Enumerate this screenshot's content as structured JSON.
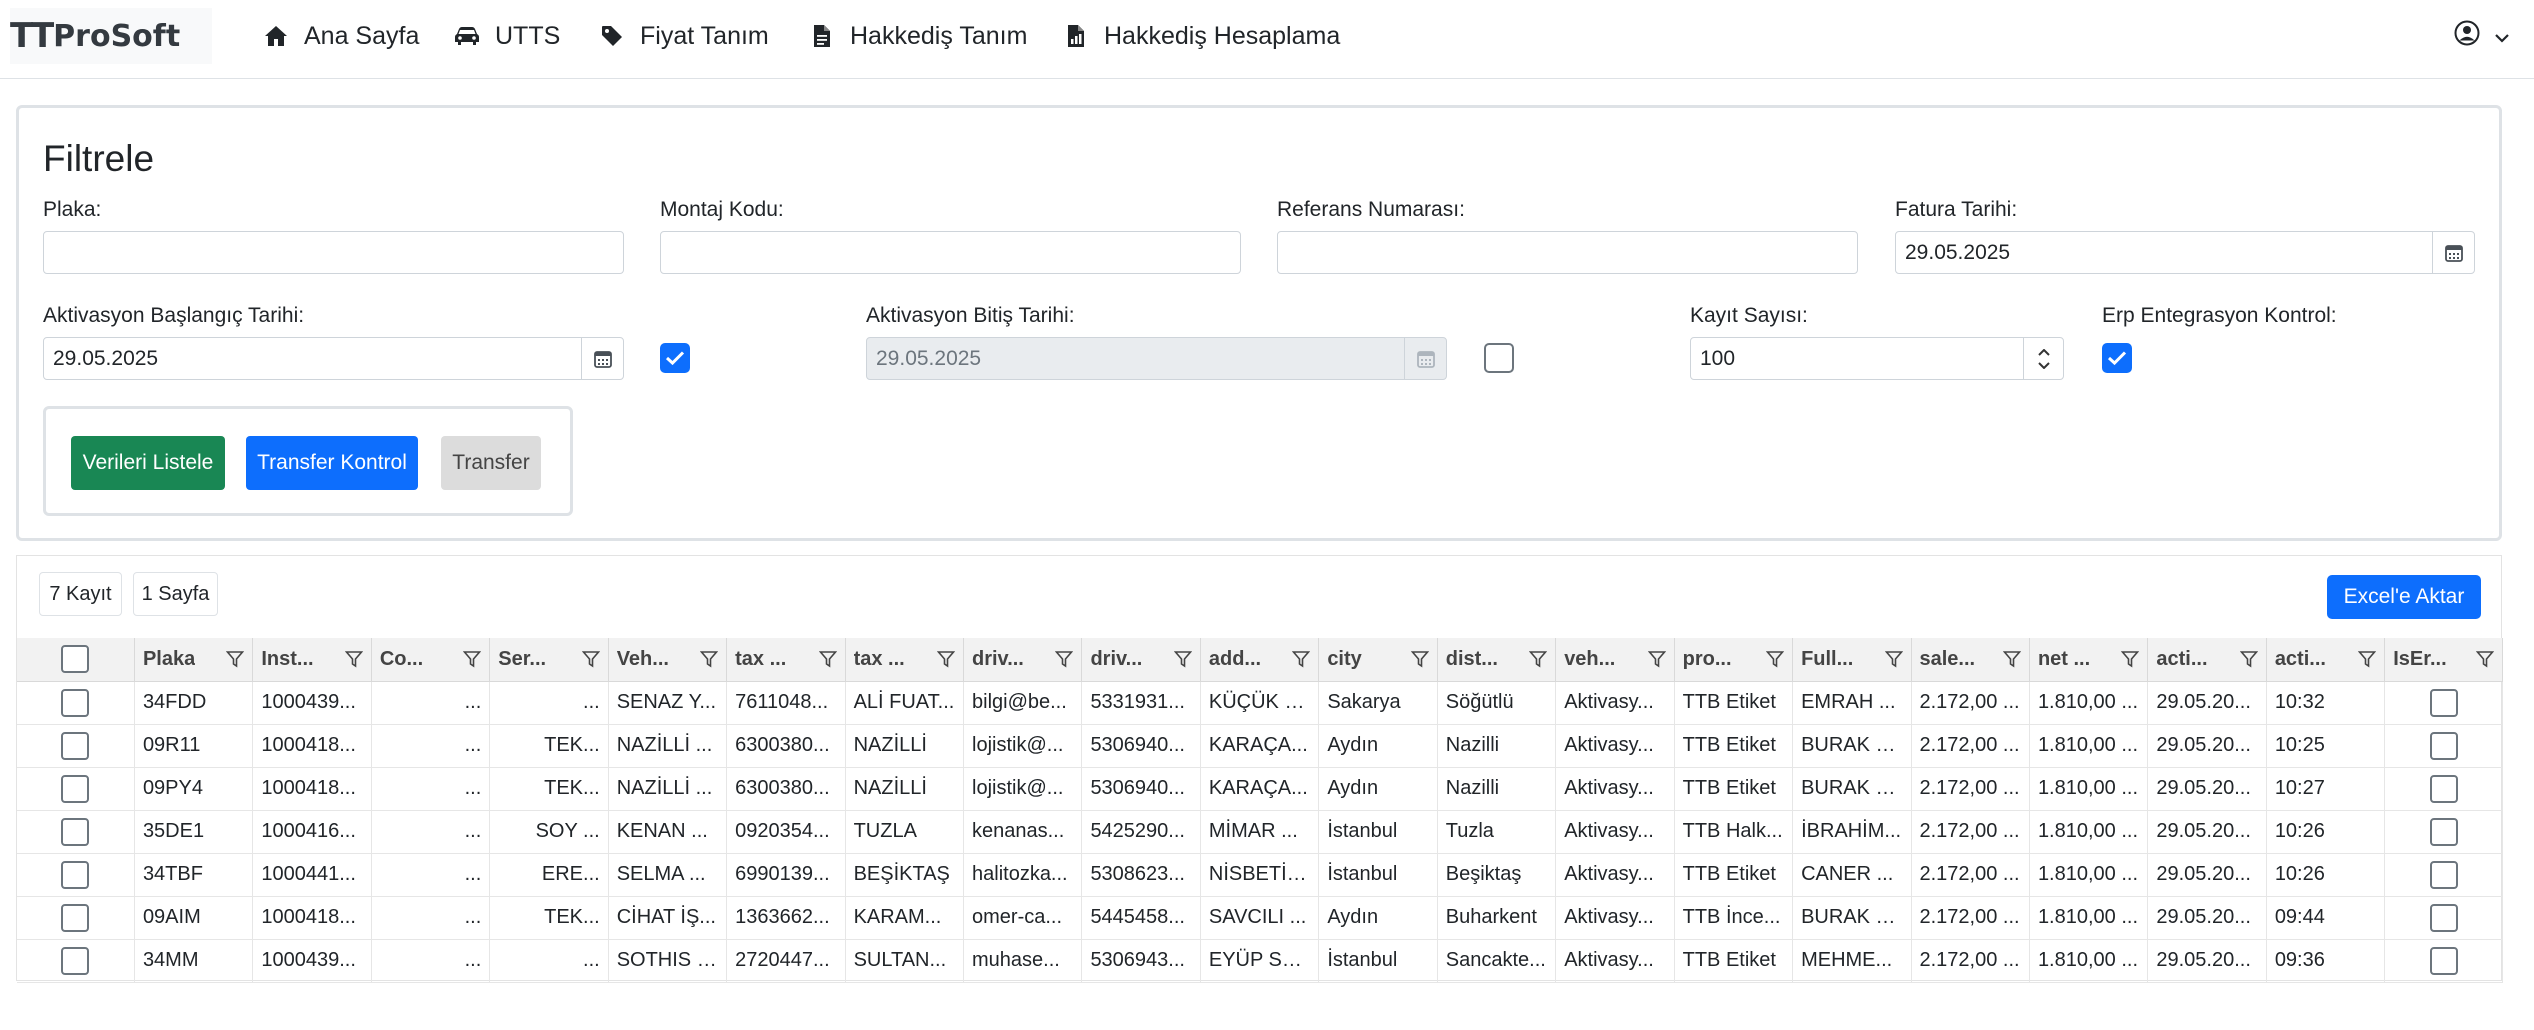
{
  "brand": {
    "logo_mark": "TT",
    "logo_text": "ProSoft"
  },
  "nav": [
    {
      "label": "Ana Sayfa",
      "icon": "home-icon"
    },
    {
      "label": "UTTS",
      "icon": "car-icon"
    },
    {
      "label": "Fiyat Tanım",
      "icon": "tag-icon"
    },
    {
      "label": "Hakkediş Tanım",
      "icon": "file-icon"
    },
    {
      "label": "Hakkediş Hesaplama",
      "icon": "file-chart-icon"
    }
  ],
  "filter": {
    "title": "Filtrele",
    "plaka": {
      "label": "Plaka:",
      "value": ""
    },
    "montaj": {
      "label": "Montaj Kodu:",
      "value": ""
    },
    "referans": {
      "label": "Referans Numarası:",
      "value": ""
    },
    "fatura": {
      "label": "Fatura Tarihi:",
      "value": "29.05.2025"
    },
    "aktivasyon_baslangic": {
      "label": "Aktivasyon Başlangıç Tarihi:",
      "value": "29.05.2025",
      "checked": true
    },
    "aktivasyon_bitis": {
      "label": "Aktivasyon Bitiş Tarihi:",
      "value": "29.05.2025",
      "checked": false
    },
    "kayit_sayisi": {
      "label": "Kayıt Sayısı:",
      "value": "100"
    },
    "erp": {
      "label": "Erp Entegrasyon Kontrol:",
      "checked": true
    },
    "buttons": {
      "listele": "Verileri Listele",
      "transfer_kontrol": "Transfer Kontrol",
      "transfer": "Transfer"
    }
  },
  "grid": {
    "record_count": "7 Kayıt",
    "page_count": "1 Sayfa",
    "excel_label": "Excel'e Aktar",
    "columns": [
      "Plaka",
      "Inst...",
      "Co...",
      "Ser...",
      "Veh...",
      "tax ...",
      "tax ...",
      "driv...",
      "driv...",
      "add...",
      "city",
      "dist...",
      "veh...",
      "pro...",
      "Full...",
      "sale...",
      "net ...",
      "acti...",
      "acti...",
      "IsEr..."
    ],
    "rows": [
      [
        "34FDD",
        "1000439...",
        "...",
        "...",
        "SENAZ Y...",
        "7611048...",
        "ALİ FUAT...",
        "bilgi@be...",
        "5331931...",
        "KÜÇÜK S...",
        "Sakarya",
        "Söğütlü",
        "Aktivasy...",
        "TTB Etiket",
        "EMRAH ...",
        "2.172,00 ...",
        "1.810,00 ...",
        "29.05.20...",
        "10:32"
      ],
      [
        "09R11",
        "1000418...",
        "...",
        "TEK...",
        "NAZİLLİ ...",
        "6300380...",
        "NAZİLLİ",
        "lojistik@...",
        "5306940...",
        "KARAÇA...",
        "Aydın",
        "Nazilli",
        "Aktivasy...",
        "TTB Etiket",
        "BURAK B...",
        "2.172,00 ...",
        "1.810,00 ...",
        "29.05.20...",
        "10:25"
      ],
      [
        "09PY4",
        "1000418...",
        "...",
        "TEK...",
        "NAZİLLİ ...",
        "6300380...",
        "NAZİLLİ",
        "lojistik@...",
        "5306940...",
        "KARAÇA...",
        "Aydın",
        "Nazilli",
        "Aktivasy...",
        "TTB Etiket",
        "BURAK B...",
        "2.172,00 ...",
        "1.810,00 ...",
        "29.05.20...",
        "10:27"
      ],
      [
        "35DE1",
        "1000416...",
        "...",
        "SOY ...",
        "KENAN ...",
        "0920354...",
        "TUZLA",
        "kenanas...",
        "5425290...",
        "MİMAR ...",
        "İstanbul",
        "Tuzla",
        "Aktivasy...",
        "TTB Halk...",
        "İBRAHİM...",
        "2.172,00 ...",
        "1.810,00 ...",
        "29.05.20...",
        "10:26"
      ],
      [
        "34TBF",
        "1000441...",
        "...",
        "ERE...",
        "SELMA ...",
        "6990139...",
        "BEŞİKTAŞ",
        "halitozka...",
        "5308623...",
        "NİSBETİY...",
        "İstanbul",
        "Beşiktaş",
        "Aktivasy...",
        "TTB Etiket",
        "CANER ...",
        "2.172,00 ...",
        "1.810,00 ...",
        "29.05.20...",
        "10:26"
      ],
      [
        "09AIM",
        "1000418...",
        "...",
        "TEK...",
        "CİHAT İŞ...",
        "1363662...",
        "KARAM...",
        "omer-ca...",
        "5445458...",
        "SAVCILI ...",
        "Aydın",
        "Buharkent",
        "Aktivasy...",
        "TTB İnce...",
        "BURAK B...",
        "2.172,00 ...",
        "1.810,00 ...",
        "29.05.20...",
        "09:44"
      ],
      [
        "34MM",
        "1000439...",
        "...",
        "...",
        "SOTHIS I...",
        "2720447...",
        "SULTAN...",
        "muhase...",
        "5306943...",
        "EYÜP SU...",
        "İstanbul",
        "Sancakte...",
        "Aktivasy...",
        "TTB Etiket",
        "MEHME...",
        "2.172,00 ...",
        "1.810,00 ...",
        "29.05.20...",
        "09:36"
      ]
    ]
  }
}
